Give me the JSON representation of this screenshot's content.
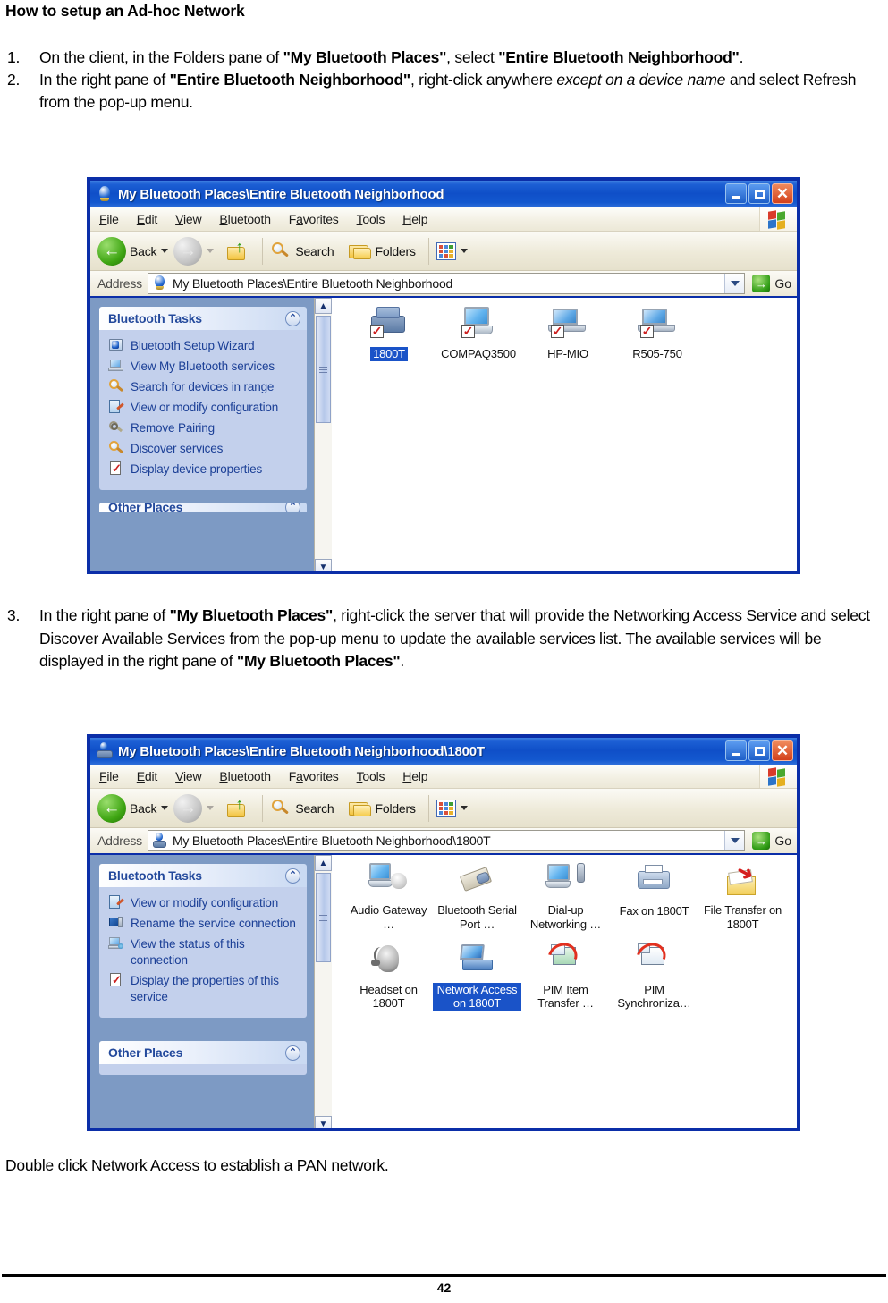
{
  "document": {
    "title": "How to setup an Ad-hoc Network",
    "steps": [
      {
        "num": "1.",
        "html_parts": [
          {
            "t": "On the client, in the Folders pane of ",
            "s": "normal"
          },
          {
            "t": "\"My Bluetooth Places\"",
            "s": "bold"
          },
          {
            "t": ", select ",
            "s": "normal"
          },
          {
            "t": "\"Entire Bluetooth Neighborhood\"",
            "s": "bold"
          },
          {
            "t": ".",
            "s": "normal"
          }
        ]
      },
      {
        "num": "2.",
        "html_parts": [
          {
            "t": "In the right pane of ",
            "s": "normal"
          },
          {
            "t": "\"Entire Bluetooth Neighborhood\"",
            "s": "bold"
          },
          {
            "t": ", right-click anywhere ",
            "s": "normal"
          },
          {
            "t": "except on a device name",
            "s": "italic"
          },
          {
            "t": " and select Refresh from the pop-up menu.",
            "s": "normal"
          }
        ]
      },
      {
        "num": "3.",
        "html_parts": [
          {
            "t": "In the right pane of ",
            "s": "normal"
          },
          {
            "t": "\"My Bluetooth Places\"",
            "s": "bold"
          },
          {
            "t": ", right-click the server that will provide the Networking Access Service and select Discover Available Services from the pop-up menu to update the available services list. The available services will be displayed in the right pane of ",
            "s": "normal"
          },
          {
            "t": "\"My Bluetooth Places\"",
            "s": "bold"
          },
          {
            "t": ".",
            "s": "normal"
          }
        ]
      }
    ],
    "closing_text": "Double click Network Access to establish a PAN network.",
    "page_number": "42"
  },
  "common": {
    "menu_items": [
      {
        "label": "File",
        "accel": "F"
      },
      {
        "label": "Edit",
        "accel": "E"
      },
      {
        "label": "View",
        "accel": "V"
      },
      {
        "label": "Bluetooth",
        "accel": "B"
      },
      {
        "label": "Favorites",
        "accel": "a"
      },
      {
        "label": "Tools",
        "accel": "T"
      },
      {
        "label": "Help",
        "accel": "H"
      }
    ],
    "toolbar": {
      "back_label": "Back",
      "search_label": "Search",
      "folders_label": "Folders"
    },
    "address_label": "Address",
    "go_label": "Go",
    "panel_bluetooth_tasks": "Bluetooth Tasks",
    "panel_other_places": "Other Places",
    "colors": {
      "title_blue": "#0f4fc8",
      "window_border": "#0b2ea8",
      "sidepane_blue": "#7d9ac4",
      "panel_body": "#c3d0ec",
      "panel_heading_text": "#23499c",
      "task_link": "#1b3f96",
      "selection_blue": "#1a53c8"
    }
  },
  "window1": {
    "title": "My Bluetooth Places\\Entire Bluetooth Neighborhood",
    "title_icon": "bluetooth-globe-icon",
    "address_value": "My Bluetooth Places\\Entire Bluetooth Neighborhood",
    "tasks": [
      {
        "label": "Bluetooth Setup Wizard",
        "icon": "bluetooth-wizard-icon"
      },
      {
        "label": "View My Bluetooth services",
        "icon": "laptop-services-icon"
      },
      {
        "label": "Search for devices in range",
        "icon": "magnifier-icon"
      },
      {
        "label": "View or modify configuration",
        "icon": "configuration-icon"
      },
      {
        "label": "Remove Pairing",
        "icon": "keys-icon"
      },
      {
        "label": "Discover services",
        "icon": "magnifier-icon"
      },
      {
        "label": "Display device properties",
        "icon": "document-check-icon"
      }
    ],
    "devices": [
      {
        "label": "1800T",
        "icon": "bluetooth-printer-device-icon",
        "selected": true
      },
      {
        "label": "COMPAQ3500",
        "icon": "desktop-computer-icon",
        "selected": false
      },
      {
        "label": "HP-MIO",
        "icon": "laptop-computer-icon",
        "selected": false
      },
      {
        "label": "R505-750",
        "icon": "laptop-computer-icon",
        "selected": false
      }
    ]
  },
  "window2": {
    "title": "My Bluetooth Places\\Entire Bluetooth Neighborhood\\1800T",
    "title_icon": "bluetooth-printer-icon",
    "address_value": "My Bluetooth Places\\Entire Bluetooth Neighborhood\\1800T",
    "tasks": [
      {
        "label": "View or modify configuration",
        "icon": "configuration-icon"
      },
      {
        "label": "Rename the service connection",
        "icon": "rename-service-icon"
      },
      {
        "label": "View the status of this connection",
        "icon": "connection-status-icon"
      },
      {
        "label": "Display the properties of this service",
        "icon": "document-check-icon"
      }
    ],
    "services": [
      {
        "label": "Audio Gateway …",
        "icon": "audio-gateway-icon",
        "selected": false
      },
      {
        "label": "Bluetooth Serial Port …",
        "icon": "serial-port-icon",
        "selected": false
      },
      {
        "label": "Dial-up Networking …",
        "icon": "dialup-networking-icon",
        "selected": false
      },
      {
        "label": "Fax on 1800T",
        "icon": "fax-icon",
        "selected": false
      },
      {
        "label": "File Transfer on 1800T",
        "icon": "file-transfer-icon",
        "selected": false
      },
      {
        "label": "Headset on 1800T",
        "icon": "headset-icon",
        "selected": false
      },
      {
        "label": "Network Access on 1800T",
        "icon": "network-access-icon",
        "selected": true
      },
      {
        "label": "PIM Item Transfer …",
        "icon": "pim-item-transfer-icon",
        "selected": false
      },
      {
        "label": "PIM Synchroniza…",
        "icon": "pim-synchronization-icon",
        "selected": false
      }
    ]
  }
}
